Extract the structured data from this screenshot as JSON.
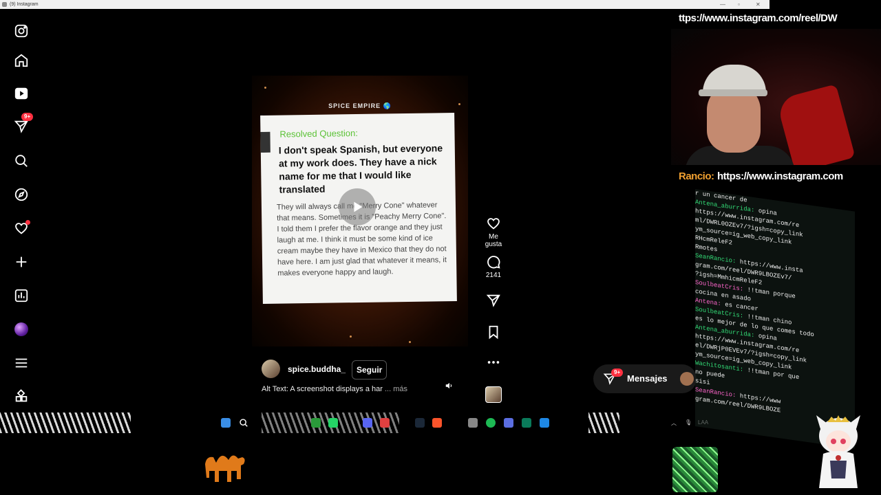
{
  "window": {
    "title": "(9) Instagram"
  },
  "nav": {
    "items": [
      {
        "name": "instagram-logo-icon"
      },
      {
        "name": "home-icon"
      },
      {
        "name": "reels-icon"
      },
      {
        "name": "messages-icon",
        "badge": "9+"
      },
      {
        "name": "search-icon"
      },
      {
        "name": "explore-icon"
      },
      {
        "name": "notifications-icon"
      },
      {
        "name": "create-icon"
      },
      {
        "name": "dashboard-icon"
      },
      {
        "name": "profile-avatar"
      },
      {
        "name": "more-menu-icon"
      },
      {
        "name": "threads-apps-icon"
      }
    ]
  },
  "reel": {
    "brand": "SPICE EMPIRE 🌎",
    "resolved_label": "Resolved Question:",
    "question": "I don't speak Spanish, but everyone at my work does. They have a nick name for me that I would like translated",
    "body": "They will always call me \"Merry Cone\" whatever that means. Sometimes it is \"Peachy Merry Cone\". I told them I prefer the flavor orange and they just laugh at me. I think it must be some kind of ice cream maybe they have in Mexico that they do not have here. I am just glad that whatever it means, it makes everyone happy and laugh."
  },
  "author": {
    "username": "spice.buddha_",
    "follow_label": "Seguir"
  },
  "caption": {
    "text": "Alt Text: A screenshot displays a har",
    "more_label": "... más"
  },
  "actions": {
    "like_label": "Me gusta",
    "comments_count": "2141"
  },
  "messages": {
    "badge": "9+",
    "label": "Mensajes"
  },
  "overlay": {
    "url_top": "ttps://www.instagram.com/reel/DW",
    "chat_name": "Rancio:",
    "chat_url": "https://www.instagram.com",
    "chat_lines": [
      {
        "user": "",
        "text": "r un cancer de"
      },
      {
        "user": "Antena_aburrida:",
        "text": "opina"
      },
      {
        "user": "",
        "text": "https://www.instagram.com/re"
      },
      {
        "user": "",
        "text": "ml/DWRL0OZEv7/?igsh=copy_link"
      },
      {
        "user": "",
        "text": "ym_source=ig_web_copy_link"
      },
      {
        "user": "",
        "text": "RHcmReleF2"
      },
      {
        "user": "",
        "text": "Rmotes"
      },
      {
        "user": "SeanRancio:",
        "text": "https://www.insta"
      },
      {
        "user": "",
        "text": "gram.com/reel/DWR9LBOZEv7/"
      },
      {
        "user": "",
        "text": "?igsh=MmhicmReleF2"
      },
      {
        "user": "SoulbeatCris:",
        "text": "!!tman porque"
      },
      {
        "user": "",
        "text": "cocina en asado"
      },
      {
        "user": "Antena:",
        "text": "es cancer"
      },
      {
        "user": "SoulbeatCris:",
        "text": "!!tman chino"
      },
      {
        "user": "",
        "text": "es lo mejor de lo que comes todo"
      },
      {
        "user": "Antena_aburrida:",
        "text": "opina"
      },
      {
        "user": "",
        "text": "https://www.instagram.com/re"
      },
      {
        "user": "",
        "text": "el/DWRjP0EVEv7/?igsh=copy_link"
      },
      {
        "user": "",
        "text": "ym_source=ig_web_copy_link"
      },
      {
        "user": "Wachitosanti:",
        "text": "!!tman por que"
      },
      {
        "user": "",
        "text": "no puede"
      },
      {
        "user": "",
        "text": "sisi"
      },
      {
        "user": "SeanRancio:",
        "text": "https://www"
      },
      {
        "user": "",
        "text": "gram.com/reel/DWR9LBOZE"
      }
    ]
  },
  "colors": {
    "badge": "#ff3040",
    "resolved": "#5bc236",
    "chat_name": "#f0a030"
  }
}
